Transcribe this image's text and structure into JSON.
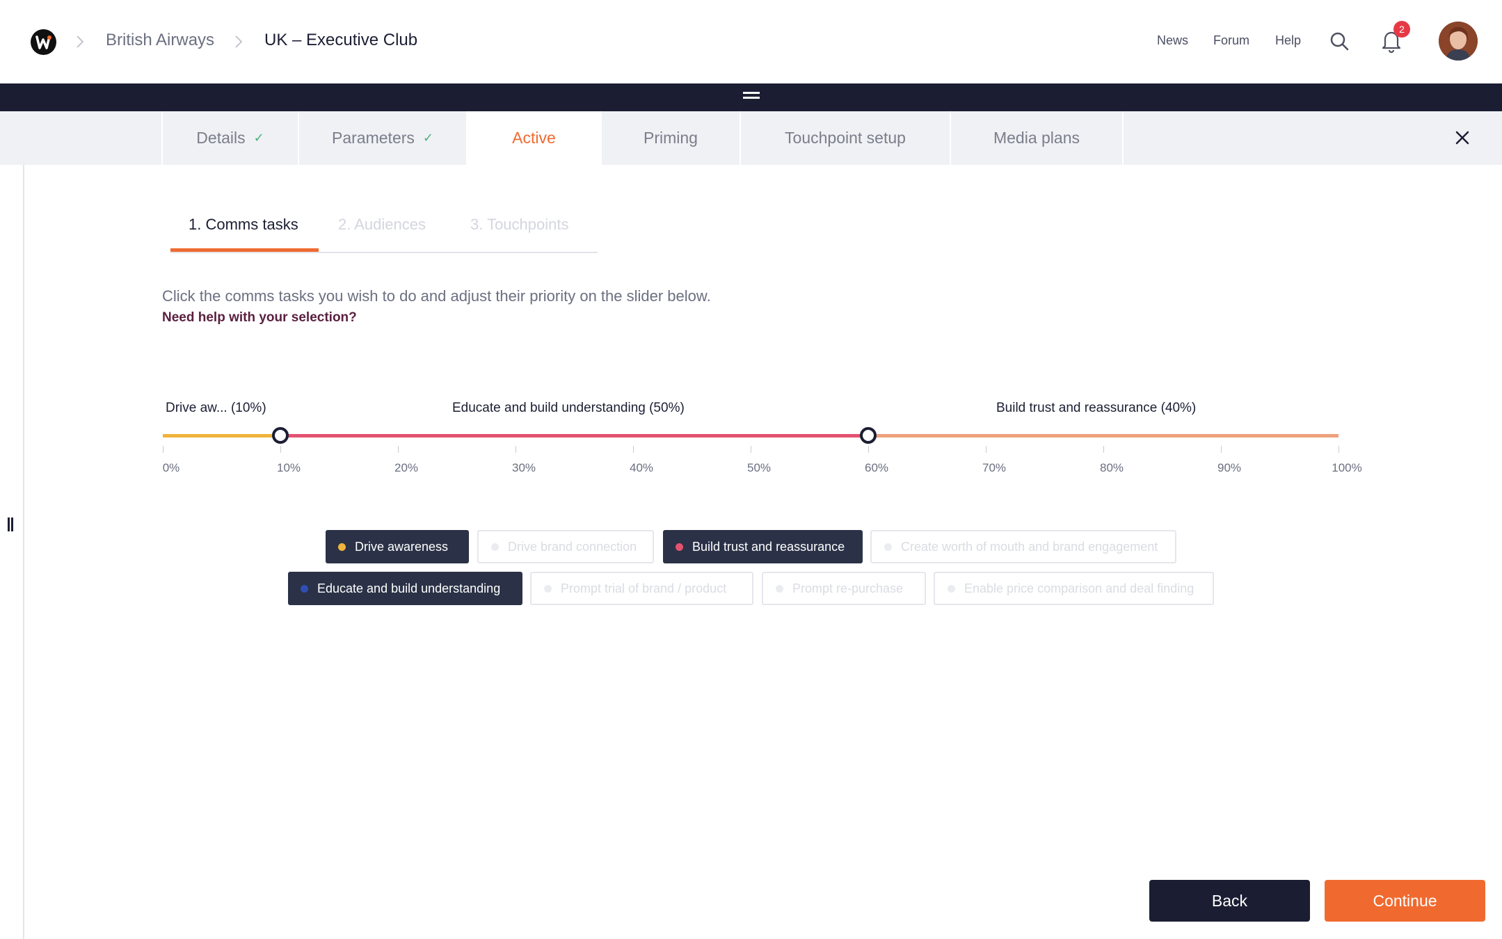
{
  "header": {
    "breadcrumbs": [
      "British Airways",
      "UK – Executive Club"
    ],
    "nav_links": [
      "News",
      "Forum",
      "Help"
    ],
    "notification_count": "2"
  },
  "steps": [
    {
      "label": "Details",
      "completed": true
    },
    {
      "label": "Parameters",
      "completed": true
    },
    {
      "label": "Active",
      "active": true
    },
    {
      "label": "Priming"
    },
    {
      "label": "Touchpoint setup"
    },
    {
      "label": "Media plans"
    }
  ],
  "subtabs": [
    "1. Comms tasks",
    "2. Audiences",
    "3. Touchpoints"
  ],
  "instructions": "Click the comms tasks you wish to do and adjust their priority on the slider below.",
  "help_link": "Need help with your selection?",
  "slider": {
    "segments": [
      {
        "label": "Drive aw... (10%)",
        "start_percent": 0,
        "end_percent": 10,
        "color": "#f0b43c"
      },
      {
        "label": "Educate and build understanding (50%)",
        "start_percent": 10,
        "end_percent": 60,
        "color": "#e45270"
      },
      {
        "label": "Build trust and reassurance (40%)",
        "start_percent": 60,
        "end_percent": 100,
        "color": "#eda27c"
      }
    ],
    "handles_percent": [
      10,
      60
    ],
    "tick_labels": [
      "0%",
      "10%",
      "20%",
      "30%",
      "40%",
      "50%",
      "60%",
      "70%",
      "80%",
      "90%",
      "100%"
    ]
  },
  "comms_tasks": [
    {
      "label": "Drive awareness",
      "selected": true,
      "color": "#f0b43c"
    },
    {
      "label": "Drive brand connection",
      "selected": false
    },
    {
      "label": "Build trust and reassurance",
      "selected": true,
      "color": "#e45270"
    },
    {
      "label": "Create worth of mouth and brand engagement",
      "selected": false
    },
    {
      "label": "Educate and build understanding",
      "selected": true,
      "color": "#2f4fb5"
    },
    {
      "label": "Prompt trial of brand / product",
      "selected": false
    },
    {
      "label": "Prompt re-purchase",
      "selected": false
    },
    {
      "label": "Enable price comparison and deal finding",
      "selected": false
    }
  ],
  "buttons": {
    "back": "Back",
    "continue": "Continue"
  },
  "colors": {
    "accent": "#f06a2f",
    "dark": "#1b1e33",
    "chip_selected": "#2b3247"
  }
}
